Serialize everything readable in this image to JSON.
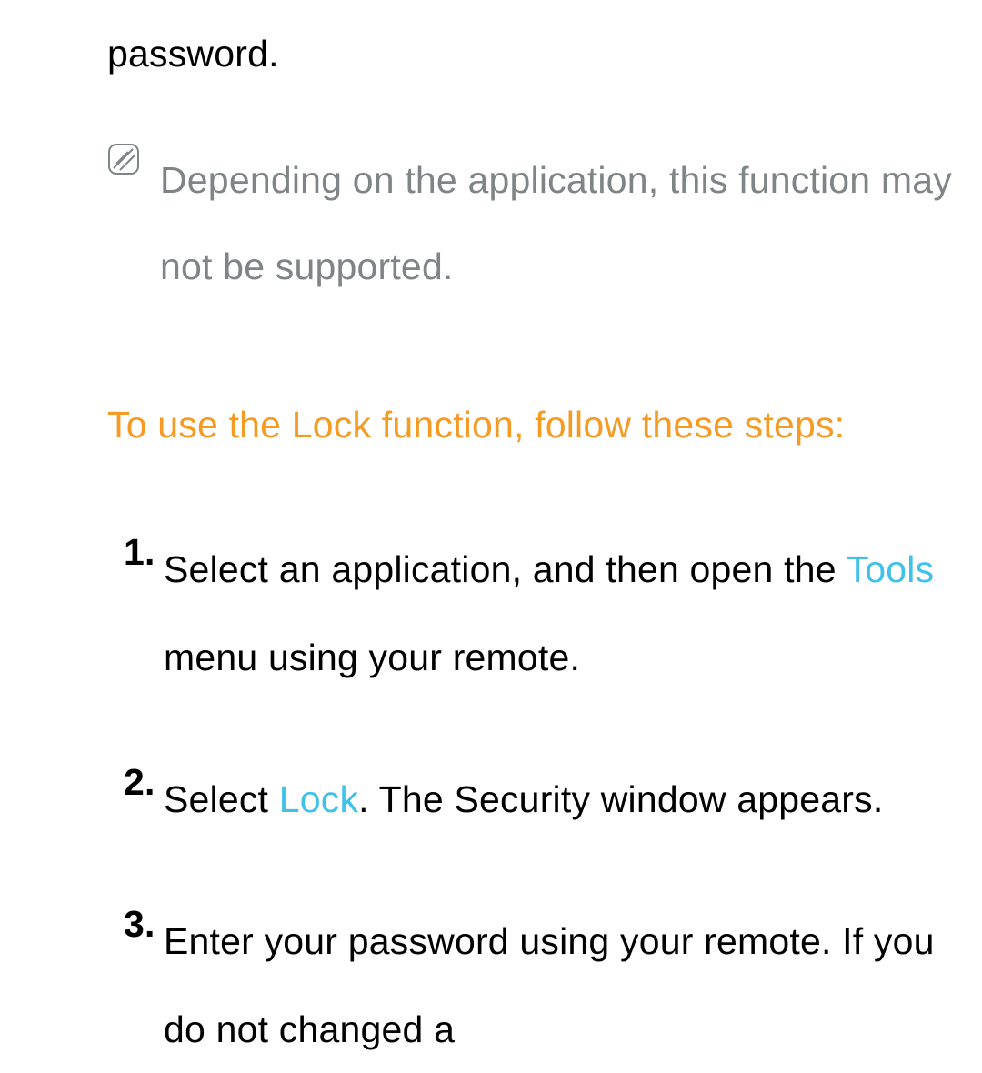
{
  "intro": "password.",
  "note": "Depending on the application, this function may not be supported.",
  "heading": "To use the Lock function, follow these steps:",
  "steps": [
    {
      "num": "1.",
      "segments": [
        {
          "text": "Select an application, and then open the "
        },
        {
          "text": "Tools",
          "kw": true
        },
        {
          "text": " menu using your remote."
        }
      ]
    },
    {
      "num": "2.",
      "segments": [
        {
          "text": "Select "
        },
        {
          "text": "Lock",
          "kw": true
        },
        {
          "text": ". The Security window appears."
        }
      ]
    },
    {
      "num": "3.",
      "segments": [
        {
          "text": "Enter your password using your remote. If you do not changed a"
        }
      ]
    }
  ]
}
